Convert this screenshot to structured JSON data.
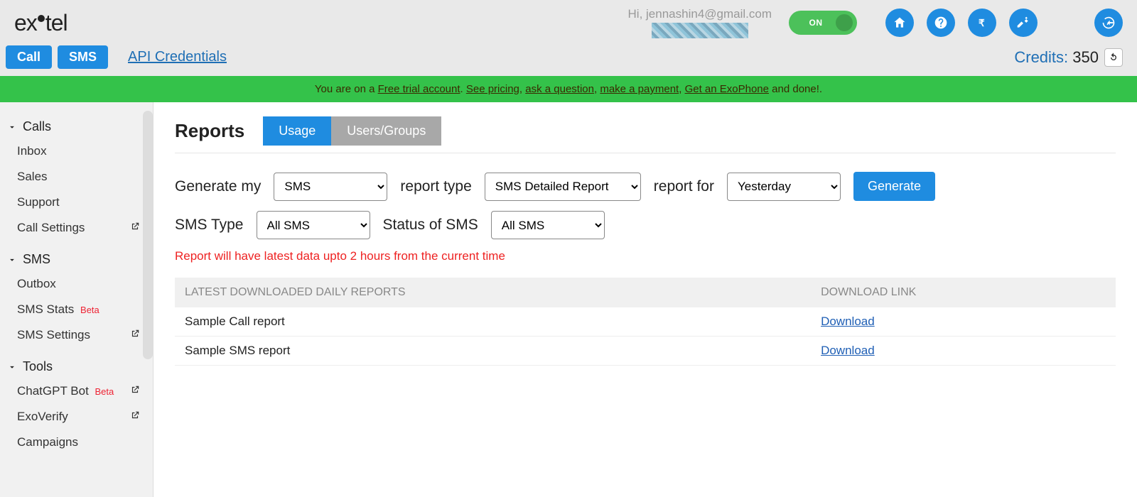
{
  "header": {
    "logo_text_left": "ex",
    "logo_text_right": "tel",
    "user_greeting": "Hi, jennashin4@gmail.com",
    "toggle_label": "ON"
  },
  "subheader": {
    "call_btn": "Call",
    "sms_btn": "SMS",
    "api_link": "API Credentials",
    "credits_label": "Credits:",
    "credits_value": "350"
  },
  "banner": {
    "prefix": "You are on a ",
    "free_trial": "Free trial account",
    "sep1": ". ",
    "see_pricing": "See pricing",
    "sep2": ", ",
    "ask_question": "ask a question",
    "sep3": ", ",
    "make_payment": "make a payment",
    "sep4": ", ",
    "get_exophone": "Get an ExoPhone",
    "suffix": " and done!."
  },
  "sidebar": {
    "groups": [
      {
        "title": "Calls",
        "items": [
          {
            "label": "Inbox",
            "beta": false,
            "ext": false
          },
          {
            "label": "Sales",
            "beta": false,
            "ext": false
          },
          {
            "label": "Support",
            "beta": false,
            "ext": false
          },
          {
            "label": "Call Settings",
            "beta": false,
            "ext": true
          }
        ]
      },
      {
        "title": "SMS",
        "items": [
          {
            "label": "Outbox",
            "beta": false,
            "ext": false
          },
          {
            "label": "SMS Stats",
            "beta": true,
            "ext": false
          },
          {
            "label": "SMS Settings",
            "beta": false,
            "ext": true
          }
        ]
      },
      {
        "title": "Tools",
        "items": [
          {
            "label": "ChatGPT Bot",
            "beta": true,
            "ext": true
          },
          {
            "label": "ExoVerify",
            "beta": false,
            "ext": true
          },
          {
            "label": "Campaigns",
            "beta": false,
            "ext": false
          }
        ]
      }
    ],
    "beta_tag": "Beta"
  },
  "page": {
    "title": "Reports",
    "tabs": {
      "usage": "Usage",
      "users": "Users/Groups"
    },
    "labels": {
      "generate_my": "Generate my",
      "report_type": "report type",
      "report_for": "report for",
      "sms_type": "SMS Type",
      "status_of_sms": "Status of SMS"
    },
    "selects": {
      "channel": "SMS",
      "report_type": "SMS Detailed Report",
      "report_for": "Yesterday",
      "sms_type": "All SMS",
      "status": "All SMS"
    },
    "generate_btn": "Generate",
    "note": "Report will have latest data upto 2 hours from the current time",
    "table": {
      "col1": "LATEST DOWNLOADED DAILY REPORTS",
      "col2": "DOWNLOAD LINK",
      "rows": [
        {
          "name": "Sample Call report",
          "link": "Download"
        },
        {
          "name": "Sample SMS report",
          "link": "Download"
        }
      ]
    }
  }
}
